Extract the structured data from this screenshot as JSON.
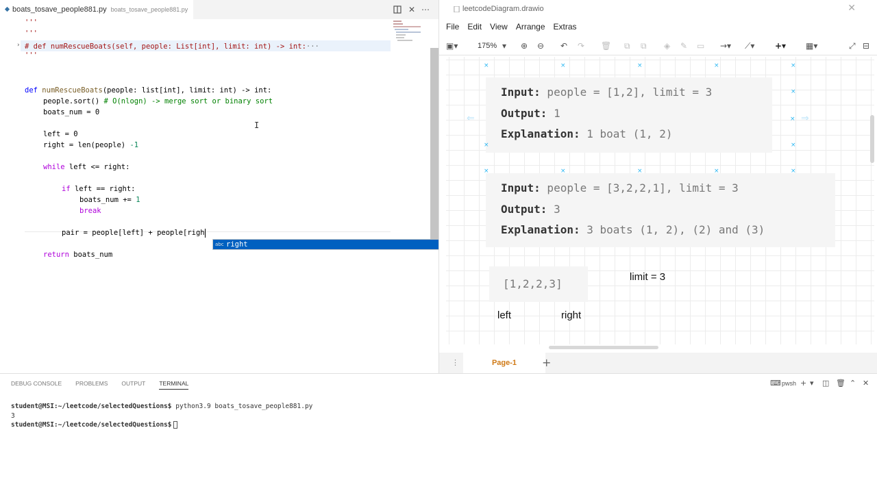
{
  "editor": {
    "tab_name": "boats_tosave_people881.py",
    "tab_path": "boats_tosave_people881.py",
    "folded_line": "# def numRescueBoats(self, people: List[int], limit: int) -> int:",
    "fold_ellipsis": "···",
    "quote": "'''",
    "code": {
      "def_kw": "def",
      "fn_name": "numRescueBoats",
      "params": "(people: list[int], limit: int) -> int:",
      "l_sort": "people.sort()",
      "l_sort_comment": "# O(nlogn) -> merge sort or binary sort",
      "l_boats": "boats_num = 0",
      "l_left": "left = 0",
      "l_right_a": "right = len(people) ",
      "l_right_b": "-1",
      "l_while_kw": "while",
      "l_while_rest": " left <= right:",
      "l_if_kw": "if",
      "l_if_rest": " left == right:",
      "l_boats_inc": "boats_num += ",
      "l_boats_inc_num": "1",
      "l_break": "break",
      "l_pair": "pair = people[left] + people[righ",
      "l_return_kw": "return",
      "l_return_rest": " boats_num"
    },
    "suggest": {
      "icon": "abc",
      "text": "right"
    }
  },
  "drawio": {
    "title": "leetcodeDiagram.drawio",
    "menu": [
      "File",
      "Edit",
      "View",
      "Arrange",
      "Extras"
    ],
    "zoom": "175%",
    "example1": {
      "input_label": "Input:",
      "input_value": " people = [1,2], limit = 3",
      "output_label": "Output:",
      "output_value": " 1",
      "explanation_label": "Explanation:",
      "explanation_value": " 1 boat (1, 2)"
    },
    "example2": {
      "input_label": "Input:",
      "input_value": " people = [3,2,2,1], limit = 3",
      "output_label": "Output:",
      "output_value": " 3",
      "explanation_label": "Explanation:",
      "explanation_value": " 3 boats (1, 2), (2) and (3)"
    },
    "array_text": "[1,2,2,3]",
    "limit_text": "limit = 3",
    "left_label": "left",
    "right_label": "right",
    "page_tab": "Page-1"
  },
  "panel": {
    "tabs": [
      "DEBUG CONSOLE",
      "PROBLEMS",
      "OUTPUT",
      "TERMINAL"
    ],
    "active_tab": "TERMINAL",
    "shell": "pwsh",
    "terminal": {
      "prompt1": "student@MSI:~/leetcode/selectedQuestions$",
      "cmd1": " python3.9 boats_tosave_people881.py",
      "output1": "3",
      "prompt2": "student@MSI:~/leetcode/selectedQuestions$"
    }
  },
  "colors": {
    "keyword": "#0000ff",
    "control": "#af00db",
    "function": "#795e26",
    "type": "#267f99",
    "number": "#098658",
    "comment": "#008000",
    "suggest_bg": "#0060c0",
    "page_tab": "#d07a16",
    "selection_handle": "#29b6f2"
  }
}
